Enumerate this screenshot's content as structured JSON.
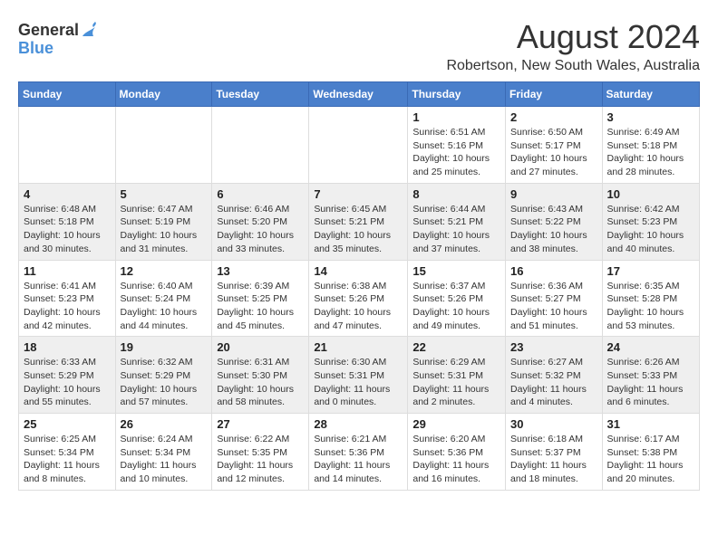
{
  "logo": {
    "general": "General",
    "blue": "Blue"
  },
  "title": {
    "month": "August 2024",
    "location": "Robertson, New South Wales, Australia"
  },
  "headers": [
    "Sunday",
    "Monday",
    "Tuesday",
    "Wednesday",
    "Thursday",
    "Friday",
    "Saturday"
  ],
  "weeks": [
    [
      {
        "day": "",
        "sunrise": "",
        "sunset": "",
        "daylight": ""
      },
      {
        "day": "",
        "sunrise": "",
        "sunset": "",
        "daylight": ""
      },
      {
        "day": "",
        "sunrise": "",
        "sunset": "",
        "daylight": ""
      },
      {
        "day": "",
        "sunrise": "",
        "sunset": "",
        "daylight": ""
      },
      {
        "day": "1",
        "sunrise": "Sunrise: 6:51 AM",
        "sunset": "Sunset: 5:16 PM",
        "daylight": "Daylight: 10 hours and 25 minutes."
      },
      {
        "day": "2",
        "sunrise": "Sunrise: 6:50 AM",
        "sunset": "Sunset: 5:17 PM",
        "daylight": "Daylight: 10 hours and 27 minutes."
      },
      {
        "day": "3",
        "sunrise": "Sunrise: 6:49 AM",
        "sunset": "Sunset: 5:18 PM",
        "daylight": "Daylight: 10 hours and 28 minutes."
      }
    ],
    [
      {
        "day": "4",
        "sunrise": "Sunrise: 6:48 AM",
        "sunset": "Sunset: 5:18 PM",
        "daylight": "Daylight: 10 hours and 30 minutes."
      },
      {
        "day": "5",
        "sunrise": "Sunrise: 6:47 AM",
        "sunset": "Sunset: 5:19 PM",
        "daylight": "Daylight: 10 hours and 31 minutes."
      },
      {
        "day": "6",
        "sunrise": "Sunrise: 6:46 AM",
        "sunset": "Sunset: 5:20 PM",
        "daylight": "Daylight: 10 hours and 33 minutes."
      },
      {
        "day": "7",
        "sunrise": "Sunrise: 6:45 AM",
        "sunset": "Sunset: 5:21 PM",
        "daylight": "Daylight: 10 hours and 35 minutes."
      },
      {
        "day": "8",
        "sunrise": "Sunrise: 6:44 AM",
        "sunset": "Sunset: 5:21 PM",
        "daylight": "Daylight: 10 hours and 37 minutes."
      },
      {
        "day": "9",
        "sunrise": "Sunrise: 6:43 AM",
        "sunset": "Sunset: 5:22 PM",
        "daylight": "Daylight: 10 hours and 38 minutes."
      },
      {
        "day": "10",
        "sunrise": "Sunrise: 6:42 AM",
        "sunset": "Sunset: 5:23 PM",
        "daylight": "Daylight: 10 hours and 40 minutes."
      }
    ],
    [
      {
        "day": "11",
        "sunrise": "Sunrise: 6:41 AM",
        "sunset": "Sunset: 5:23 PM",
        "daylight": "Daylight: 10 hours and 42 minutes."
      },
      {
        "day": "12",
        "sunrise": "Sunrise: 6:40 AM",
        "sunset": "Sunset: 5:24 PM",
        "daylight": "Daylight: 10 hours and 44 minutes."
      },
      {
        "day": "13",
        "sunrise": "Sunrise: 6:39 AM",
        "sunset": "Sunset: 5:25 PM",
        "daylight": "Daylight: 10 hours and 45 minutes."
      },
      {
        "day": "14",
        "sunrise": "Sunrise: 6:38 AM",
        "sunset": "Sunset: 5:26 PM",
        "daylight": "Daylight: 10 hours and 47 minutes."
      },
      {
        "day": "15",
        "sunrise": "Sunrise: 6:37 AM",
        "sunset": "Sunset: 5:26 PM",
        "daylight": "Daylight: 10 hours and 49 minutes."
      },
      {
        "day": "16",
        "sunrise": "Sunrise: 6:36 AM",
        "sunset": "Sunset: 5:27 PM",
        "daylight": "Daylight: 10 hours and 51 minutes."
      },
      {
        "day": "17",
        "sunrise": "Sunrise: 6:35 AM",
        "sunset": "Sunset: 5:28 PM",
        "daylight": "Daylight: 10 hours and 53 minutes."
      }
    ],
    [
      {
        "day": "18",
        "sunrise": "Sunrise: 6:33 AM",
        "sunset": "Sunset: 5:29 PM",
        "daylight": "Daylight: 10 hours and 55 minutes."
      },
      {
        "day": "19",
        "sunrise": "Sunrise: 6:32 AM",
        "sunset": "Sunset: 5:29 PM",
        "daylight": "Daylight: 10 hours and 57 minutes."
      },
      {
        "day": "20",
        "sunrise": "Sunrise: 6:31 AM",
        "sunset": "Sunset: 5:30 PM",
        "daylight": "Daylight: 10 hours and 58 minutes."
      },
      {
        "day": "21",
        "sunrise": "Sunrise: 6:30 AM",
        "sunset": "Sunset: 5:31 PM",
        "daylight": "Daylight: 11 hours and 0 minutes."
      },
      {
        "day": "22",
        "sunrise": "Sunrise: 6:29 AM",
        "sunset": "Sunset: 5:31 PM",
        "daylight": "Daylight: 11 hours and 2 minutes."
      },
      {
        "day": "23",
        "sunrise": "Sunrise: 6:27 AM",
        "sunset": "Sunset: 5:32 PM",
        "daylight": "Daylight: 11 hours and 4 minutes."
      },
      {
        "day": "24",
        "sunrise": "Sunrise: 6:26 AM",
        "sunset": "Sunset: 5:33 PM",
        "daylight": "Daylight: 11 hours and 6 minutes."
      }
    ],
    [
      {
        "day": "25",
        "sunrise": "Sunrise: 6:25 AM",
        "sunset": "Sunset: 5:34 PM",
        "daylight": "Daylight: 11 hours and 8 minutes."
      },
      {
        "day": "26",
        "sunrise": "Sunrise: 6:24 AM",
        "sunset": "Sunset: 5:34 PM",
        "daylight": "Daylight: 11 hours and 10 minutes."
      },
      {
        "day": "27",
        "sunrise": "Sunrise: 6:22 AM",
        "sunset": "Sunset: 5:35 PM",
        "daylight": "Daylight: 11 hours and 12 minutes."
      },
      {
        "day": "28",
        "sunrise": "Sunrise: 6:21 AM",
        "sunset": "Sunset: 5:36 PM",
        "daylight": "Daylight: 11 hours and 14 minutes."
      },
      {
        "day": "29",
        "sunrise": "Sunrise: 6:20 AM",
        "sunset": "Sunset: 5:36 PM",
        "daylight": "Daylight: 11 hours and 16 minutes."
      },
      {
        "day": "30",
        "sunrise": "Sunrise: 6:18 AM",
        "sunset": "Sunset: 5:37 PM",
        "daylight": "Daylight: 11 hours and 18 minutes."
      },
      {
        "day": "31",
        "sunrise": "Sunrise: 6:17 AM",
        "sunset": "Sunset: 5:38 PM",
        "daylight": "Daylight: 11 hours and 20 minutes."
      }
    ]
  ]
}
